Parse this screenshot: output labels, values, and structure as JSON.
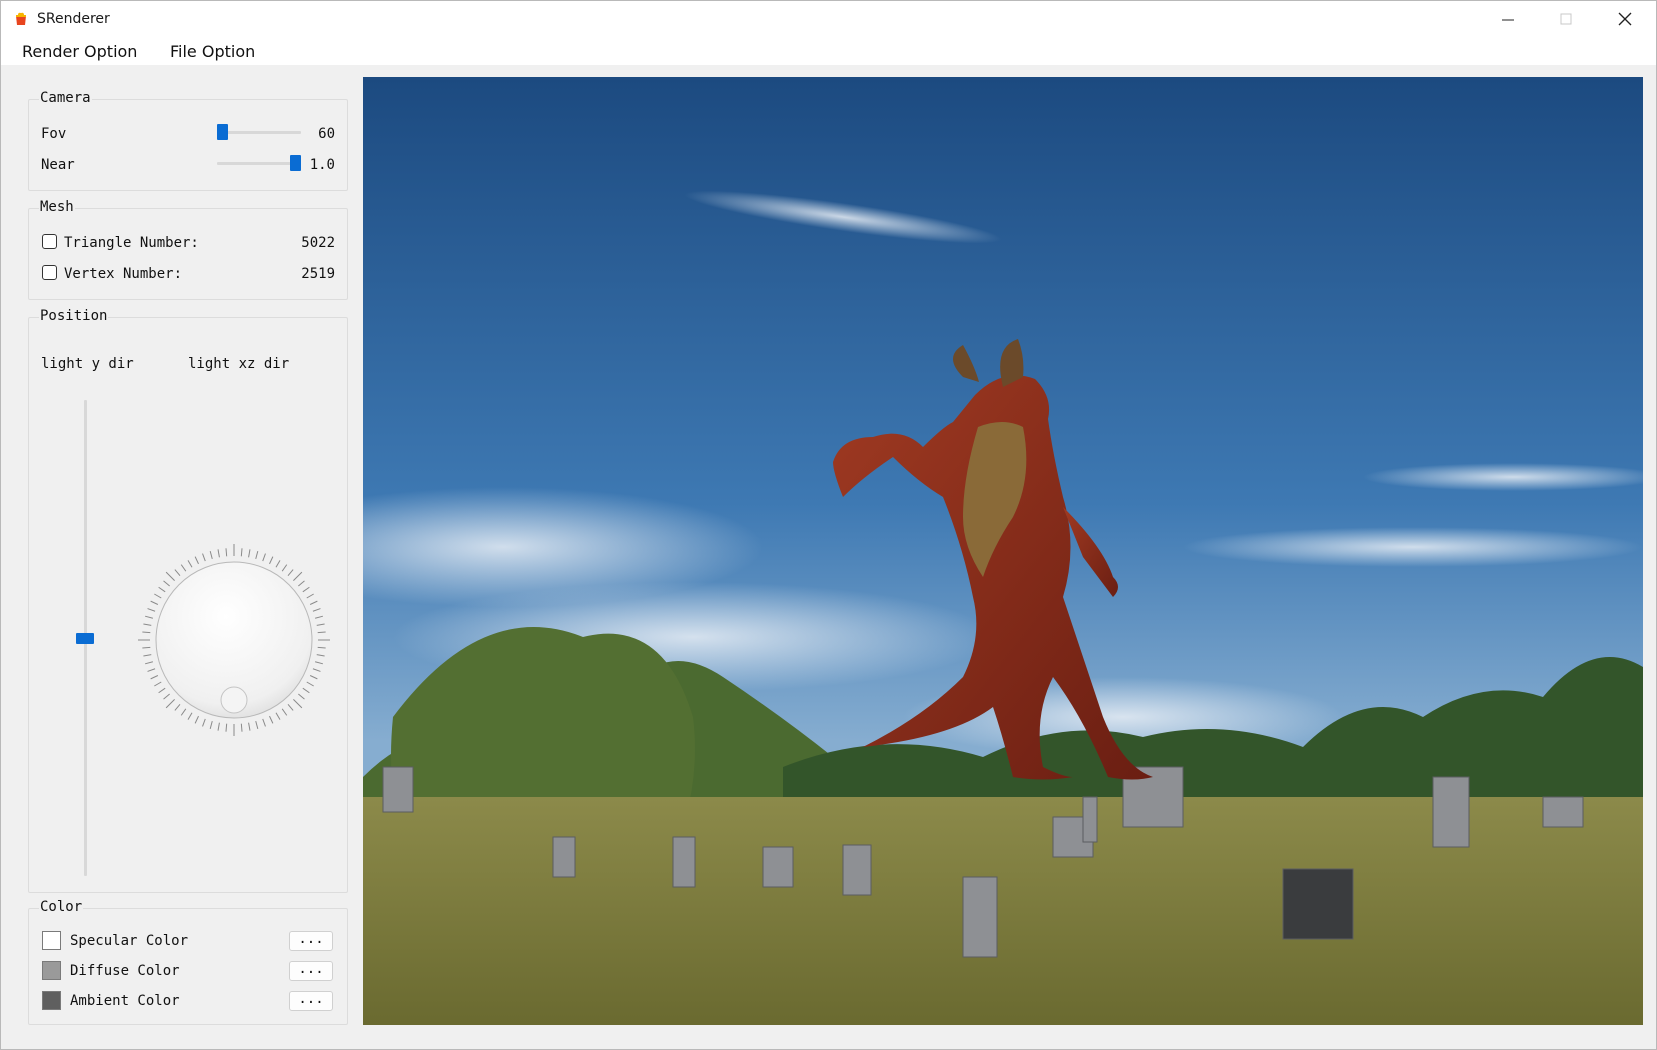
{
  "window": {
    "title": "SRenderer"
  },
  "menu": {
    "render_option": "Render Option",
    "file_option": "File Option"
  },
  "camera": {
    "title": "Camera",
    "fov_label": "Fov",
    "fov_value": "60",
    "fov_fraction": 0.0,
    "near_label": "Near",
    "near_value": "1.0",
    "near_fraction": 1.0
  },
  "mesh": {
    "title": "Mesh",
    "triangle_label": "Triangle Number:",
    "triangle_value": "5022",
    "vertex_label": "Vertex Number:",
    "vertex_value": "2519"
  },
  "position": {
    "title": "Position",
    "light_y_label": "light y dir",
    "light_xz_label": "light xz dir",
    "light_y_fraction": 0.5
  },
  "color": {
    "title": "Color",
    "specular_label": "Specular Color",
    "specular_color": "#ffffff",
    "diffuse_label": "Diffuse Color",
    "diffuse_color": "#9a9a9a",
    "ambient_label": "Ambient Color",
    "ambient_color": "#5f5f5f",
    "button_label": "..."
  },
  "viewport": {
    "scene": "rendered demon model over cemetery skybox",
    "colors": {
      "sky_top": "#1f4f86",
      "sky_bottom": "#6f9ec9",
      "grass": "#8a8a3a",
      "demon": "#8a2b1a"
    }
  }
}
